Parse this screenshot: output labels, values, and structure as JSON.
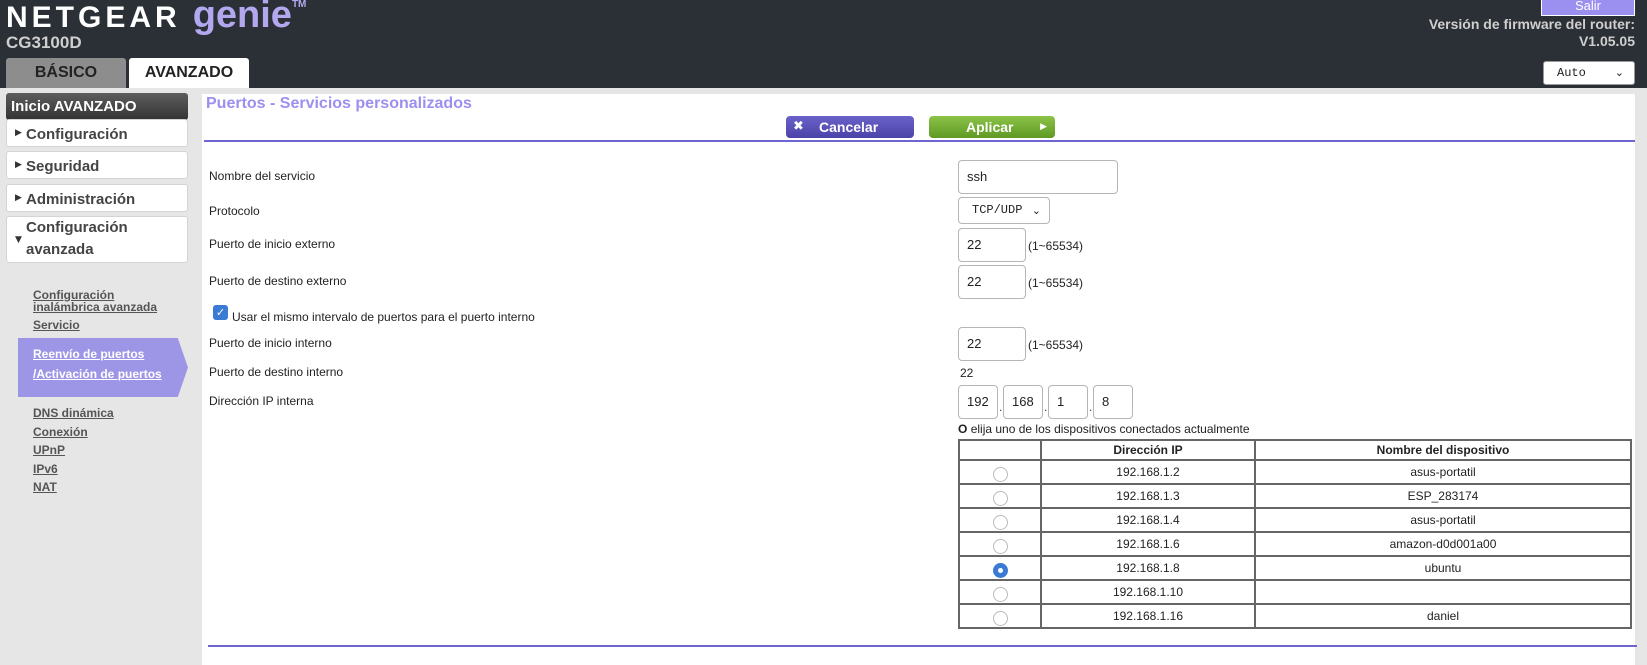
{
  "header": {
    "brand": "NETGEAR",
    "product": "genie",
    "tm": "TM",
    "model": "CG3100D",
    "logout_label": "Salir",
    "firmware_label": "Versión de firmware del router:",
    "firmware_value": "V1.05.05",
    "language": "Auto",
    "tabs": [
      "BÁSICO",
      "AVANZADO"
    ]
  },
  "sidebar": {
    "home": "Inicio AVANZADO",
    "sections": [
      "Configuración",
      "Seguridad",
      "Administración",
      "Configuración",
      "avanzada"
    ],
    "links": [
      "Configuración",
      "inalámbrica avanzada",
      "Servicio",
      "Reenvío de puertos",
      "/Activación de puertos",
      "DNS dinámica",
      "Conexión",
      "UPnP",
      "IPv6",
      "NAT"
    ]
  },
  "main": {
    "title": "Puertos - Servicios personalizados",
    "cancel_label": "Cancelar",
    "apply_label": "Aplicar",
    "fields": {
      "service_name_label": "Nombre del servicio",
      "service_name_value": "ssh",
      "protocol_label": "Protocolo",
      "protocol_value": "TCP/UDP",
      "ext_start_label": "Puerto de inicio externo",
      "ext_start_value": "22",
      "ext_end_label": "Puerto de destino externo",
      "ext_end_value": "22",
      "range_hint": "(1~65534)",
      "same_range_label": "Usar el mismo intervalo de puertos para el puerto interno",
      "int_start_label": "Puerto de inicio interno",
      "int_start_value": "22",
      "int_end_label": "Puerto de destino interno",
      "int_end_value": "22",
      "ip_label": "Dirección IP interna",
      "ip_octets": [
        "192",
        "168",
        "1",
        "8"
      ],
      "or_prefix": "O",
      "or_text": "elija uno de los dispositivos conectados actualmente"
    },
    "devices": {
      "headers": [
        "Dirección IP",
        "Nombre del dispositivo"
      ],
      "rows": [
        {
          "ip": "192.168.1.2",
          "name": "asus-portatil",
          "selected": false
        },
        {
          "ip": "192.168.1.3",
          "name": "ESP_283174",
          "selected": false
        },
        {
          "ip": "192.168.1.4",
          "name": "asus-portatil",
          "selected": false
        },
        {
          "ip": "192.168.1.6",
          "name": "amazon-d0d001a00",
          "selected": false
        },
        {
          "ip": "192.168.1.8",
          "name": "ubuntu",
          "selected": true
        },
        {
          "ip": "192.168.1.10",
          "name": "",
          "selected": false
        },
        {
          "ip": "192.168.1.16",
          "name": "daniel",
          "selected": false
        }
      ]
    }
  }
}
